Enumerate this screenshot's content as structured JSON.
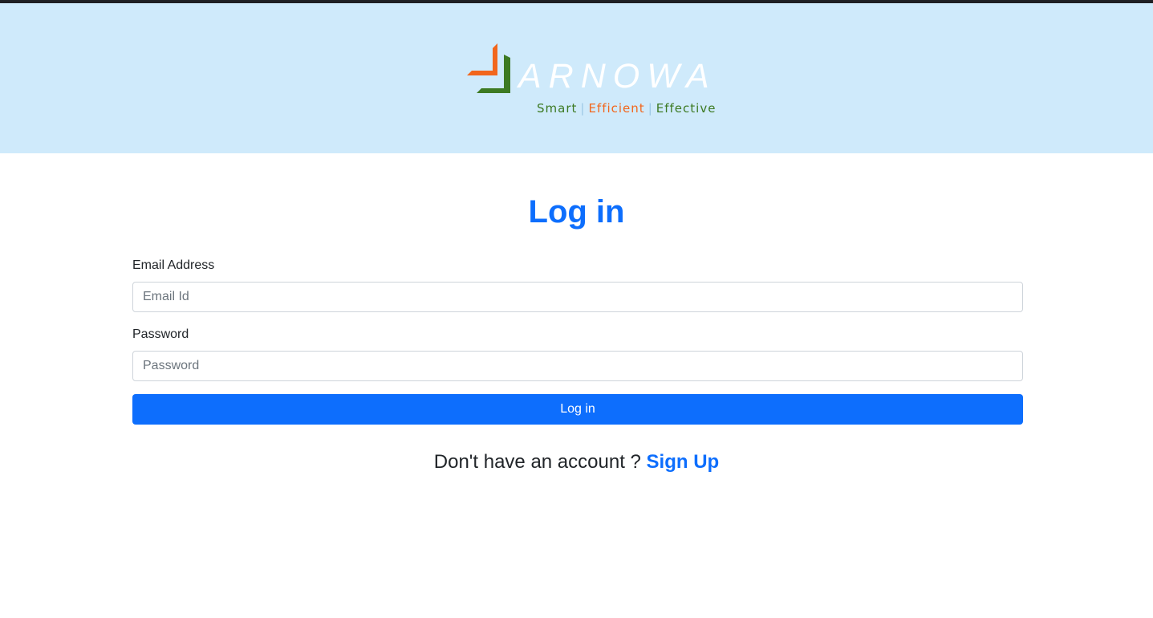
{
  "header": {
    "logo": {
      "wordmark": "ARNOWA",
      "tagline": {
        "smart": "Smart",
        "efficient": "Efficient",
        "effective": "Effective",
        "separator": "|"
      },
      "colors": {
        "orange": "#f2661c",
        "green": "#3d7a23",
        "header_bg": "#cfeafb"
      }
    }
  },
  "form": {
    "title": "Log in",
    "email": {
      "label": "Email Address",
      "placeholder": "Email Id",
      "value": ""
    },
    "password": {
      "label": "Password",
      "placeholder": "Password",
      "value": ""
    },
    "submit_label": "Log in",
    "accent_color": "#0d6efd"
  },
  "footer": {
    "prompt": "Don't have an account ?",
    "signup_label": "Sign Up"
  }
}
